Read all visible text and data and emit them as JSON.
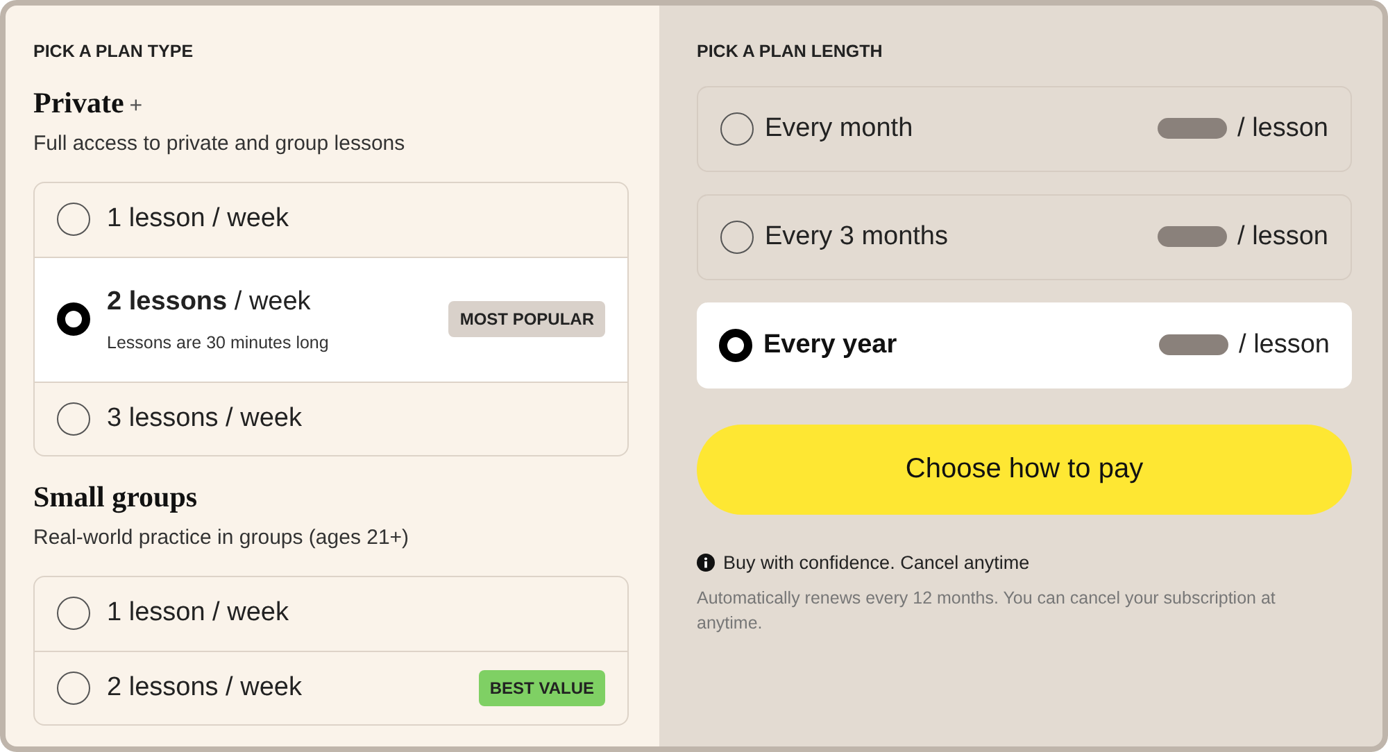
{
  "plan_type": {
    "header": "PICK A PLAN TYPE",
    "groups": [
      {
        "title": "Private",
        "title_mark": "+",
        "description": "Full access to private and group lessons",
        "options": [
          {
            "label": "1 lesson / week",
            "selected": false
          },
          {
            "label": "**2 lessons** / week",
            "note": "Lessons are 30 minutes long",
            "badge": {
              "text": "MOST POPULAR",
              "color": "#d9d1ca"
            },
            "selected": true
          },
          {
            "label": "3 lessons / week",
            "selected": false
          }
        ]
      },
      {
        "title": "Small groups",
        "description": "Real-world practice in groups (ages 21+)",
        "options": [
          {
            "label": "1 lesson / week",
            "selected": false
          },
          {
            "label": "2 lessons / week",
            "badge": {
              "text": "BEST VALUE",
              "color": "#7fd064"
            },
            "selected": false
          }
        ]
      }
    ]
  },
  "plan_length": {
    "header": "PICK A PLAN LENGTH",
    "options": [
      {
        "label": "Every month",
        "unit": "/ lesson",
        "selected": false
      },
      {
        "label": "Every 3 months",
        "unit": "/ lesson",
        "selected": false
      },
      {
        "label": "Every year",
        "unit": "/ lesson",
        "selected": true
      }
    ],
    "button": "Choose how to pay",
    "info": "Buy with confidence. Cancel anytime",
    "footnote": "Automatically renews every 12 months. You can cancel your subscription at anytime."
  }
}
